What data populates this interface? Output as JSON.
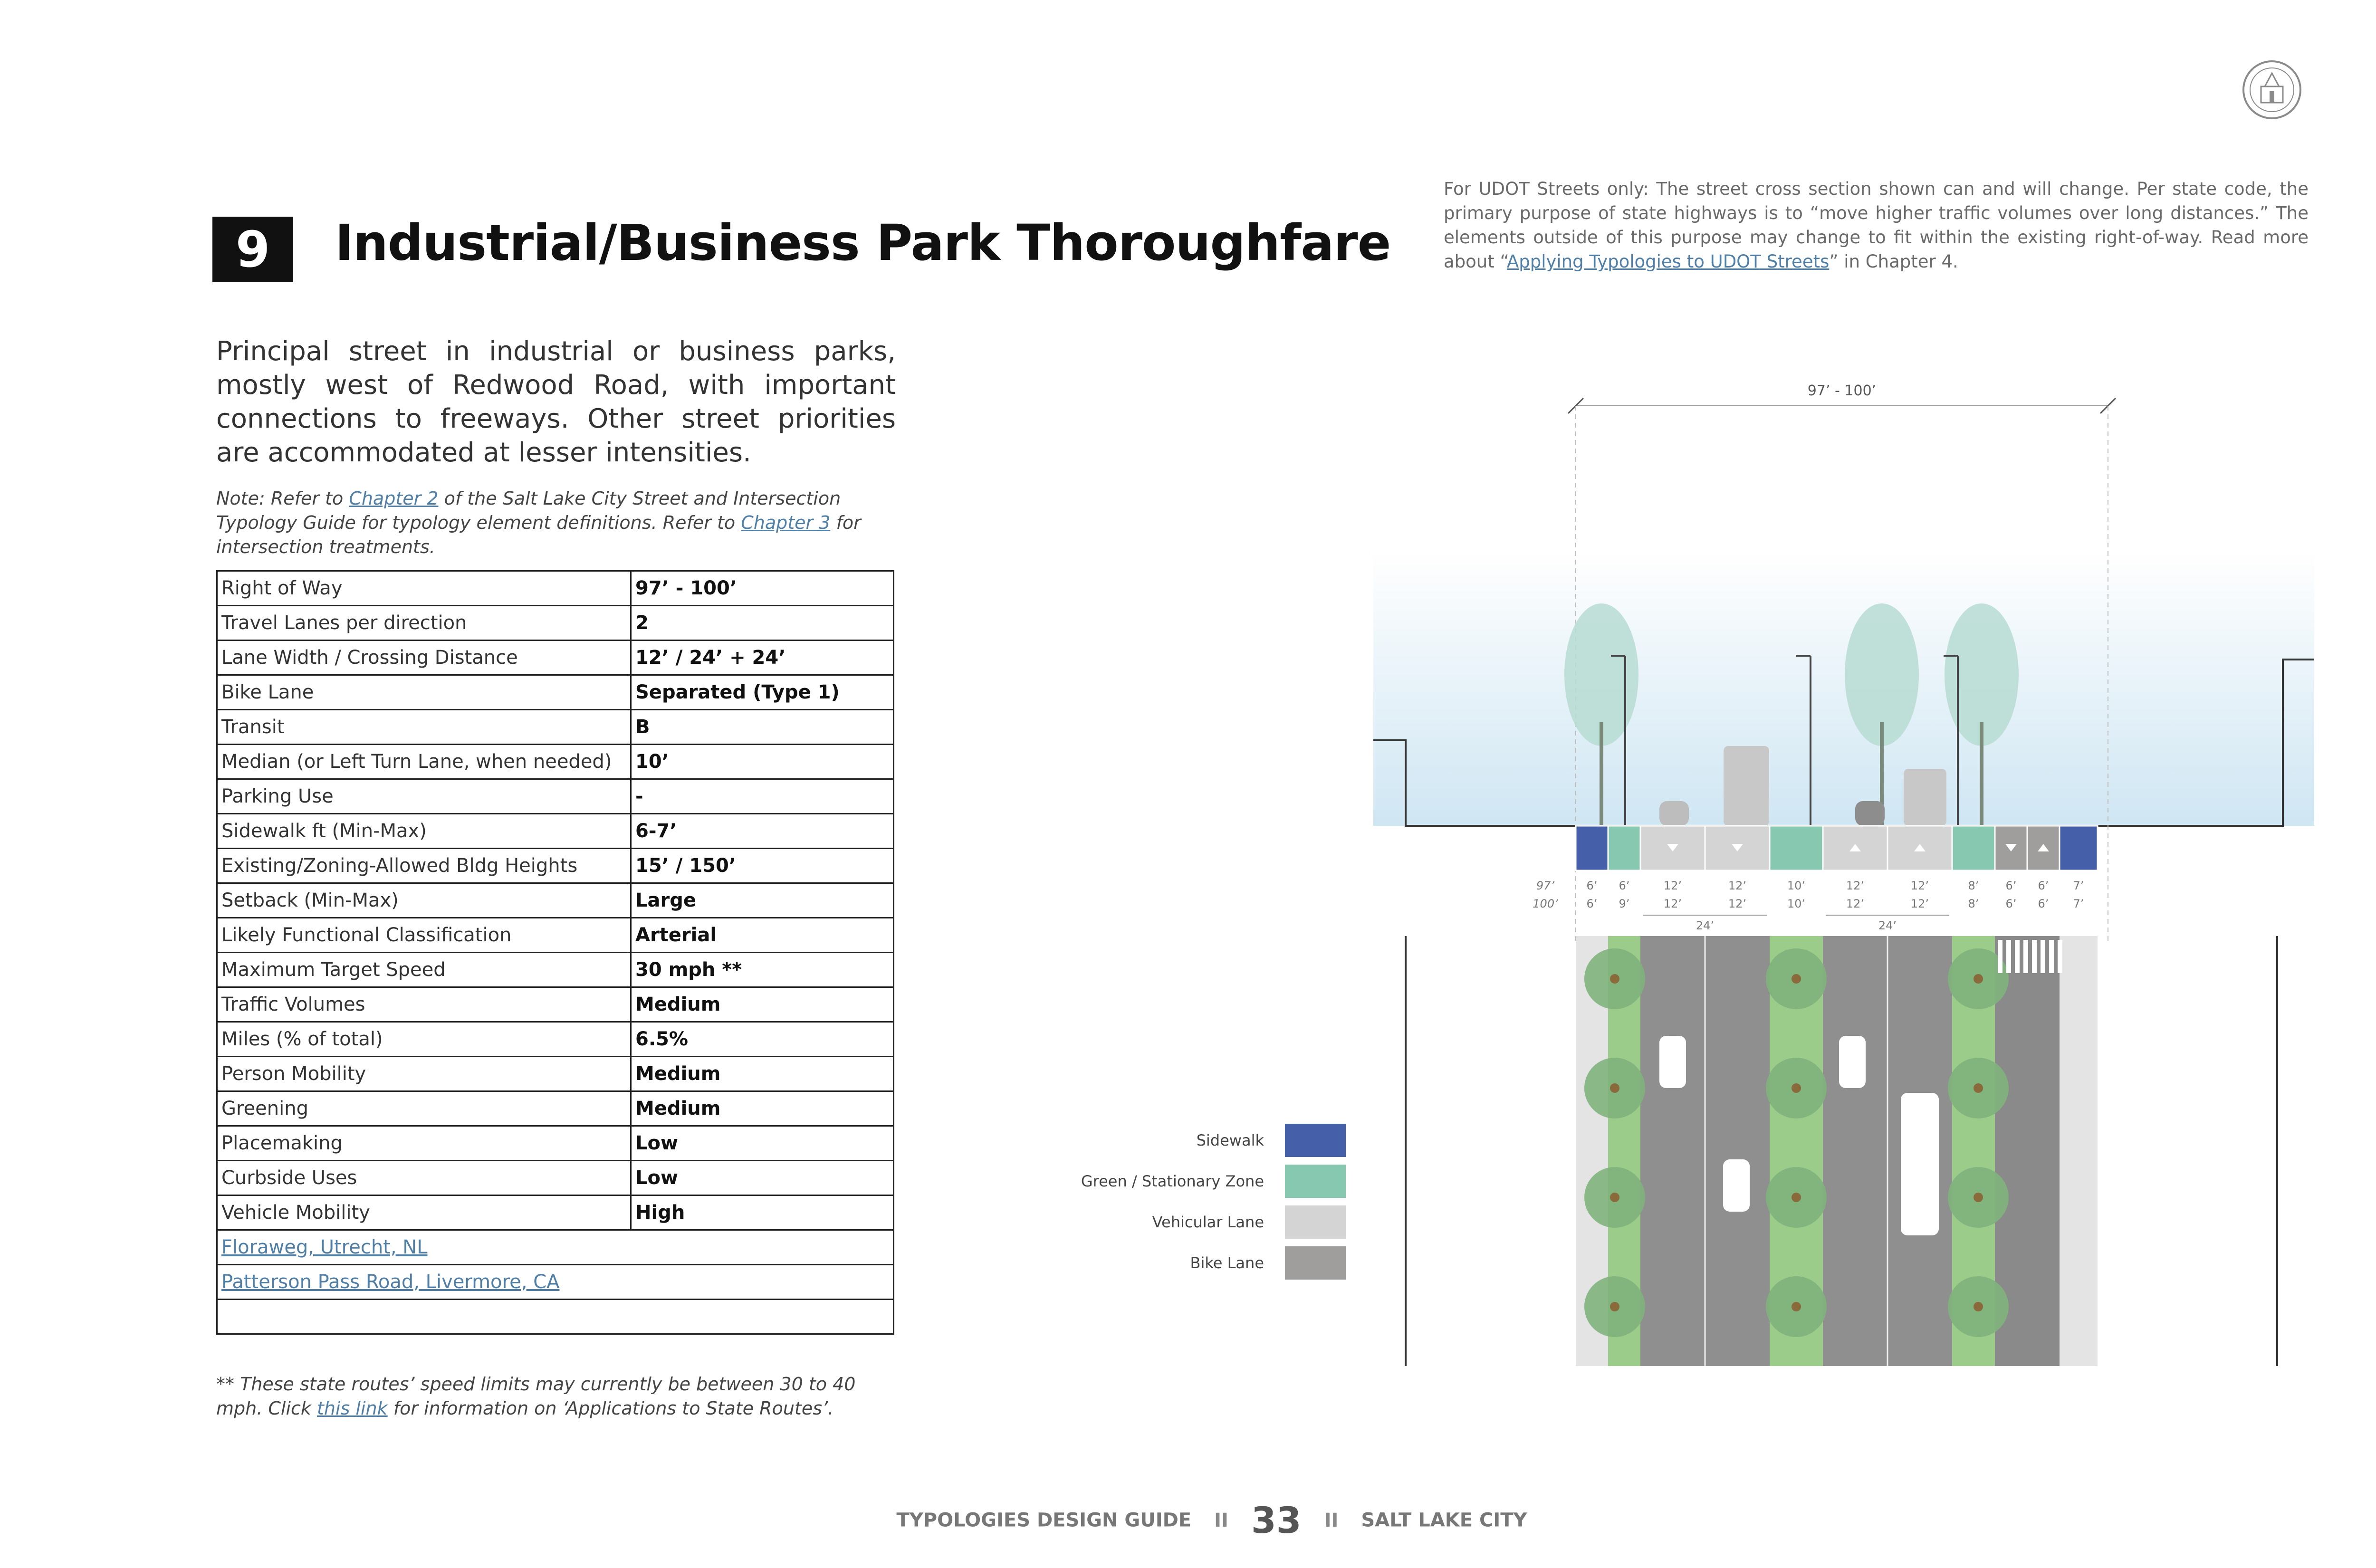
{
  "header": {
    "number": "9",
    "title": "Industrial/Business Park Thoroughfare",
    "udot_note_pre": "For UDOT Streets only: The street cross section shown can and will change. Per state code, the primary purpose of state highways is to “move higher traffic volumes over long distances.” The elements outside of this purpose may change to fit within the existing right-of-way. Read more about “",
    "udot_note_link": "Applying Typologies to UDOT Streets",
    "udot_note_post": "” in Chapter 4."
  },
  "intro": "Principal street in industrial or business parks, mostly west of Redwood Road, with important connections to freeways. Other street priorities are accommodated at lesser intensities.",
  "note": {
    "part1": "Note: Refer to ",
    "link1": "Chapter 2",
    "part2": " of the Salt Lake City Street and Intersection Typology Guide for typology element definitions. Refer to ",
    "link2": "Chapter 3",
    "part3": " for intersection treatments."
  },
  "table": {
    "rows": [
      {
        "label": "Right of Way",
        "value": "97’ - 100’"
      },
      {
        "label": "Travel Lanes per direction",
        "value": "2"
      },
      {
        "label": "Lane Width / Crossing Distance",
        "value": "12’ / 24’ + 24’"
      },
      {
        "label": "Bike Lane",
        "value": "Separated (Type 1)"
      },
      {
        "label": "Transit",
        "value": "B"
      },
      {
        "label": "Median (or Left Turn Lane, when needed)",
        "value": "10’"
      },
      {
        "label": "Parking Use",
        "value": "-"
      },
      {
        "label": "Sidewalk ft (Min-Max)",
        "value": "6-7’"
      },
      {
        "label": "Existing/Zoning-Allowed Bldg Heights",
        "value": "15’ / 150’"
      },
      {
        "label": "Setback (Min-Max)",
        "value": "Large"
      },
      {
        "label": "Likely Functional Classification",
        "value": "Arterial"
      },
      {
        "label": "Maximum Target Speed",
        "value": "30 mph **"
      },
      {
        "label": "Traffic Volumes",
        "value": "Medium"
      },
      {
        "label": "Miles (% of total)",
        "value": "6.5%"
      },
      {
        "label": "Person Mobility",
        "value": "Medium"
      },
      {
        "label": "Greening",
        "value": "Medium"
      },
      {
        "label": "Placemaking",
        "value": "Low"
      },
      {
        "label": "Curbside Uses",
        "value": "Low"
      },
      {
        "label": "Vehicle Mobility",
        "value": "High"
      }
    ],
    "example_links": [
      "Floraweg, Utrecht, NL",
      "Patterson Pass Road, Livermore, CA"
    ]
  },
  "footnote": {
    "part1": "** These state routes’ speed limits may currently be between 30 to 40 mph. Click ",
    "link": "this link",
    "part2": " for information on ‘Applications to State Routes’."
  },
  "legend": [
    {
      "label": "Sidewalk",
      "color": "#4560a8"
    },
    {
      "label": "Green / Stationary Zone",
      "color": "#86c9b0"
    },
    {
      "label": "Vehicular Lane",
      "color": "#d4d4d4"
    },
    {
      "label": "Bike Lane",
      "color": "#a09e9c"
    }
  ],
  "diagram": {
    "total_width": "97’ - 100’",
    "edge_dims": [
      "97’",
      "100’"
    ],
    "segments": [
      {
        "type": "sidewalk",
        "top": "6’",
        "bottom": "6’",
        "arrow": ""
      },
      {
        "type": "green",
        "top": "6’",
        "bottom": "9’",
        "arrow": ""
      },
      {
        "type": "vehicle",
        "top": "12’",
        "bottom": "12’",
        "arrow": "down"
      },
      {
        "type": "vehicle",
        "top": "12’",
        "bottom": "12’",
        "arrow": "down"
      },
      {
        "type": "green",
        "top": "10’",
        "bottom": "10’",
        "arrow": ""
      },
      {
        "type": "vehicle",
        "top": "12’",
        "bottom": "12’",
        "arrow": "up"
      },
      {
        "type": "vehicle",
        "top": "12’",
        "bottom": "12’",
        "arrow": "up"
      },
      {
        "type": "green",
        "top": "8’",
        "bottom": "8’",
        "arrow": ""
      },
      {
        "type": "bike",
        "top": "6’",
        "bottom": "6’",
        "arrow": "down"
      },
      {
        "type": "bike",
        "top": "6’",
        "bottom": "6’",
        "arrow": "up"
      },
      {
        "type": "sidewalk",
        "top": "7’",
        "bottom": "7’",
        "arrow": ""
      }
    ],
    "crossing_labels": [
      "24’",
      "24’"
    ]
  },
  "footer": {
    "left": "TYPOLOGIES DESIGN GUIDE",
    "separator": "II",
    "page": "33",
    "right": "SALT LAKE CITY"
  }
}
